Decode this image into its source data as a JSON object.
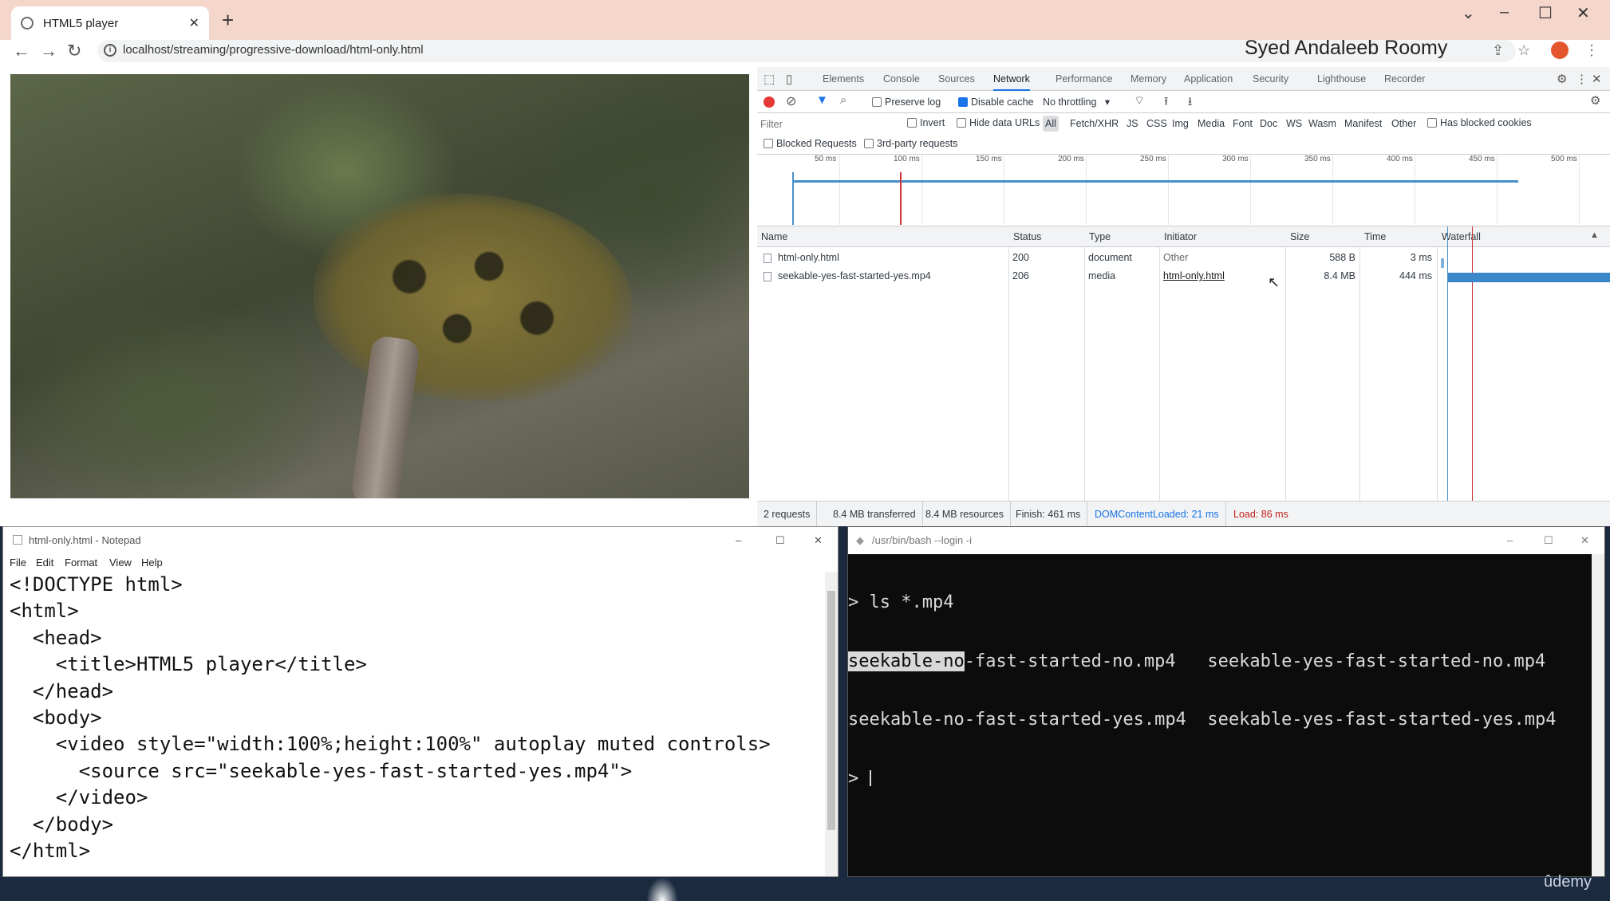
{
  "browser": {
    "tab_title": "HTML5 player",
    "url": "localhost/streaming/progressive-download/html-only.html",
    "overlay_name": "Syed Andaleeb Roomy"
  },
  "devtools": {
    "tabs": [
      "Elements",
      "Console",
      "Sources",
      "Network",
      "Performance",
      "Memory",
      "Application",
      "Security",
      "Lighthouse",
      "Recorder"
    ],
    "active_tab": "Network",
    "preserve_log": "Preserve log",
    "disable_cache": "Disable cache",
    "throttling": "No throttling",
    "filter_placeholder": "Filter",
    "invert": "Invert",
    "hide_data_urls": "Hide data URLs",
    "type_filters": [
      "All",
      "Fetch/XHR",
      "JS",
      "CSS",
      "Img",
      "Media",
      "Font",
      "Doc",
      "WS",
      "Wasm",
      "Manifest",
      "Other"
    ],
    "has_blocked_cookies": "Has blocked cookies",
    "blocked_requests": "Blocked Requests",
    "third_party": "3rd-party requests",
    "timeline_ticks": [
      "50 ms",
      "100 ms",
      "150 ms",
      "200 ms",
      "250 ms",
      "300 ms",
      "350 ms",
      "400 ms",
      "450 ms",
      "500 ms"
    ],
    "columns": [
      "Name",
      "Status",
      "Type",
      "Initiator",
      "Size",
      "Time",
      "Waterfall"
    ],
    "rows": [
      {
        "name": "html-only.html",
        "status": "200",
        "type": "document",
        "initiator": "Other",
        "size": "588 B",
        "time": "3 ms"
      },
      {
        "name": "seekable-yes-fast-started-yes.mp4",
        "status": "206",
        "type": "media",
        "initiator": "html-only.html",
        "size": "8.4 MB",
        "time": "444 ms"
      }
    ],
    "status": {
      "requests": "2 requests",
      "transferred": "8.4 MB transferred",
      "resources": "8.4 MB resources",
      "finish": "Finish: 461 ms",
      "dcl": "DOMContentLoaded: 21 ms",
      "load": "Load: 86 ms"
    }
  },
  "notepad": {
    "title": "html-only.html - Notepad",
    "menu": [
      "File",
      "Edit",
      "Format",
      "View",
      "Help"
    ],
    "content": "<!DOCTYPE html>\n<html>\n  <head>\n    <title>HTML5 player</title>\n  </head>\n  <body>\n    <video style=\"width:100%;height:100%\" autoplay muted controls>\n      <source src=\"seekable-yes-fast-started-yes.mp4\">\n    </video>\n  </body>\n</html>"
  },
  "terminal": {
    "title": "/usr/bin/bash --login -i",
    "command_line": "> ls *.mp4",
    "files": [
      "seekable-no-fast-started-no.mp4",
      "seekable-yes-fast-started-no.mp4",
      "seekable-no-fast-started-yes.mp4",
      "seekable-yes-fast-started-yes.mp4"
    ],
    "highlight": "seekable-no",
    "prompt": ">"
  },
  "watermark": "ûdemy",
  "colors": {
    "accent": "#1a73e8",
    "record": "#e53935",
    "load_red": "#c5221f",
    "tab_strip": "#f4d6cb"
  }
}
